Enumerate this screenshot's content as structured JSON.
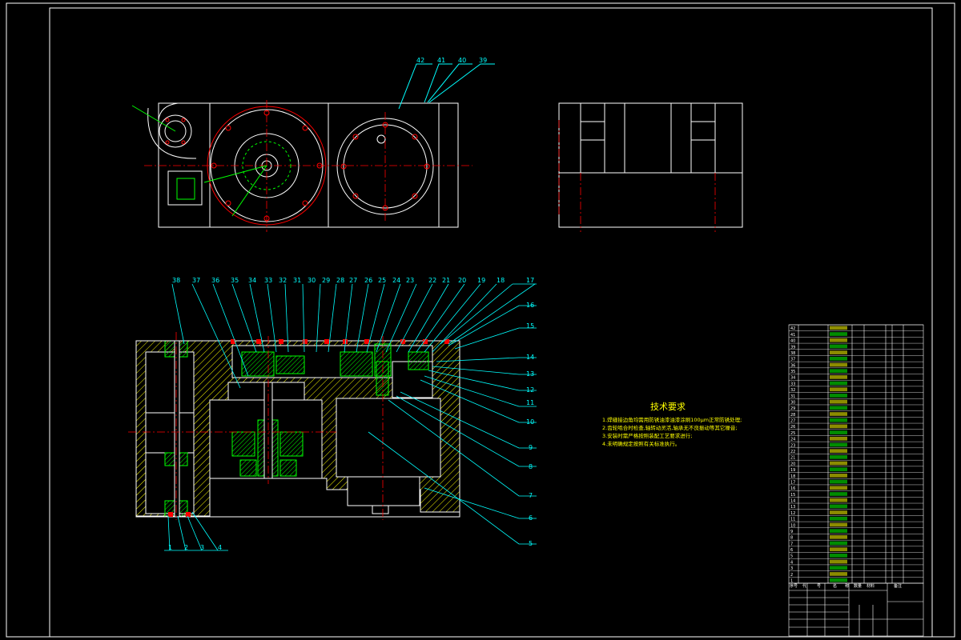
{
  "top_callouts": [
    "42",
    "41",
    "40",
    "39"
  ],
  "section_callouts_top": [
    "38",
    "37",
    "36",
    "35",
    "34",
    "33",
    "32",
    "31",
    "30",
    "29",
    "28",
    "27",
    "26",
    "25",
    "24",
    "23",
    "22",
    "21",
    "20",
    "19",
    "18",
    "17"
  ],
  "section_callouts_right": [
    "16",
    "15",
    "14",
    "13",
    "12",
    "11",
    "10",
    "9",
    "8",
    "7",
    "6",
    "5"
  ],
  "section_callouts_bottom": [
    "1",
    "2",
    "3",
    "4"
  ],
  "tech_requirements": {
    "title": "技术要求",
    "lines": [
      "1.焊缝接边角均需用防锈油漆油漆涂刷100μm正常防锈处理;",
      "2.齿轮啮合时检查,轴转动灵活,轴承无不良振动等其它噪音;",
      "3.安装时需严格按照装配工艺要求进行;",
      "4.未明确规定按照有关标准执行。"
    ]
  },
  "bom": {
    "header": [
      "序号",
      "代",
      "号",
      "名",
      "称",
      "数量",
      "材料",
      "备注"
    ],
    "row_numbers": [
      "42",
      "41",
      "40",
      "39",
      "38",
      "37",
      "36",
      "35",
      "34",
      "33",
      "32",
      "31",
      "30",
      "29",
      "28",
      "27",
      "26",
      "25",
      "24",
      "23",
      "22",
      "21",
      "20",
      "19",
      "18",
      "17",
      "16",
      "15",
      "14",
      "13",
      "12",
      "11",
      "10",
      "9",
      "8",
      "7",
      "6",
      "5",
      "4",
      "3",
      "2",
      "1"
    ]
  },
  "colors": {
    "background": "#000000",
    "outline": "#ffffff",
    "leader": "#00ffff",
    "hatch": "#ffff00",
    "gear": "#00ff00",
    "center": "#ff0000",
    "text_accent": "#ffff00"
  }
}
